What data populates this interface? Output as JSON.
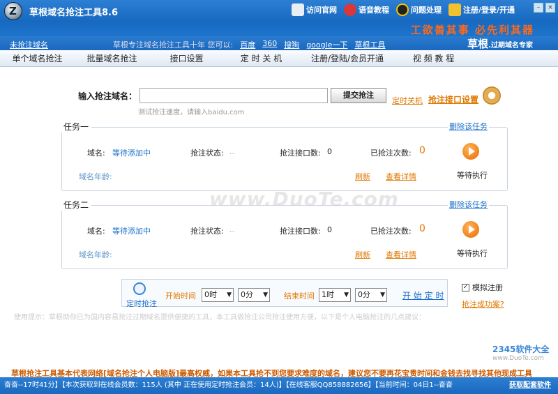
{
  "app": {
    "title": "草根域名抢注工具8.6"
  },
  "top_links": [
    {
      "label": "访问官网",
      "icon": "home-icon"
    },
    {
      "label": "语音教程",
      "icon": "music-icon"
    },
    {
      "label": "问题处理",
      "icon": "qq-penguin-icon"
    },
    {
      "label": "注册/登录/开通",
      "icon": "key-icon"
    }
  ],
  "slogan": "工欲善其事 必先利其器",
  "brand": {
    "name": "草根",
    "tagline": "过期域名专家"
  },
  "subbar": {
    "register_link": "未抢注域名",
    "notice": "草根专注域名抢注工具十年 您可以:",
    "links": [
      "百度",
      "360",
      "搜狗",
      "google一下",
      "草根工具"
    ]
  },
  "tabs": [
    "单个域名抢注",
    "批量域名抢注",
    "接口设置",
    "定 时 关 机",
    "注册/登陆/会员开通",
    "视 频 教 程"
  ],
  "main": {
    "input_label": "输入抢注域名：",
    "input_value": "",
    "submit_label": "提交抢注",
    "stop_link": "定时关机",
    "interface_link": "抢注接口设置",
    "hint": "测试抢注速度，请输入baidu.com"
  },
  "tasks": [
    {
      "title": "任务一",
      "delete_label": "删除该任务",
      "domain_label": "域名:",
      "domain_value": "等待添加中",
      "status_label": "抢注状态:",
      "status_value": "..",
      "iface_label": "抢注接口数:",
      "iface_value": "0",
      "count_label": "已抢注次数:",
      "count_value": "0",
      "age_label": "域名年龄:",
      "refresh": "刷新",
      "details": "查看详情",
      "wait": "等待执行"
    },
    {
      "title": "任务二",
      "delete_label": "删除该任务",
      "domain_label": "域名:",
      "domain_value": "等待添加中",
      "status_label": "抢注状态:",
      "status_value": "..",
      "iface_label": "抢注接口数:",
      "iface_value": "0",
      "count_label": "已抢注次数:",
      "count_value": "0",
      "age_label": "域名年龄:",
      "refresh": "刷新",
      "details": "查看详情",
      "wait": "等待执行"
    }
  ],
  "timer": {
    "label": "定时抢注",
    "start_label": "开始时间",
    "start_hour": "0时",
    "start_min": "0分",
    "end_label": "结束时间",
    "end_hour": "1时",
    "end_min": "0分",
    "start_link": "开 始 定 时"
  },
  "simulate": {
    "label": "模拟注册",
    "checked": true
  },
  "success_link": "抢注成功案?",
  "usage": "使用提示：草根助你已为国内容易抢注过期域名提供便捷的工具，本工具做抢注公司抢注使用方便，以下是个人电脑抢注的几点建议：",
  "warning": "草根抢注工具基本代表网络[域名抢注个人电脑版]最高权威，如果本工具抢不到您要求难度的域名，建议您不要再花宝贵时间和金钱去找寻找其他现成工具",
  "watermark": "www.DuoTe.com",
  "watermark_logo": {
    "name": "2345软件大全",
    "url": "www.DuoTe.com"
  },
  "status": {
    "text": "奋奋--17时41分】【本次获取到在线会员数：115人 (其中 正在使用定时抢注会员：14人)】【在线客服QQ858882656】【当前时间：04日1--奋奋",
    "right_link": "获取配套软件"
  }
}
